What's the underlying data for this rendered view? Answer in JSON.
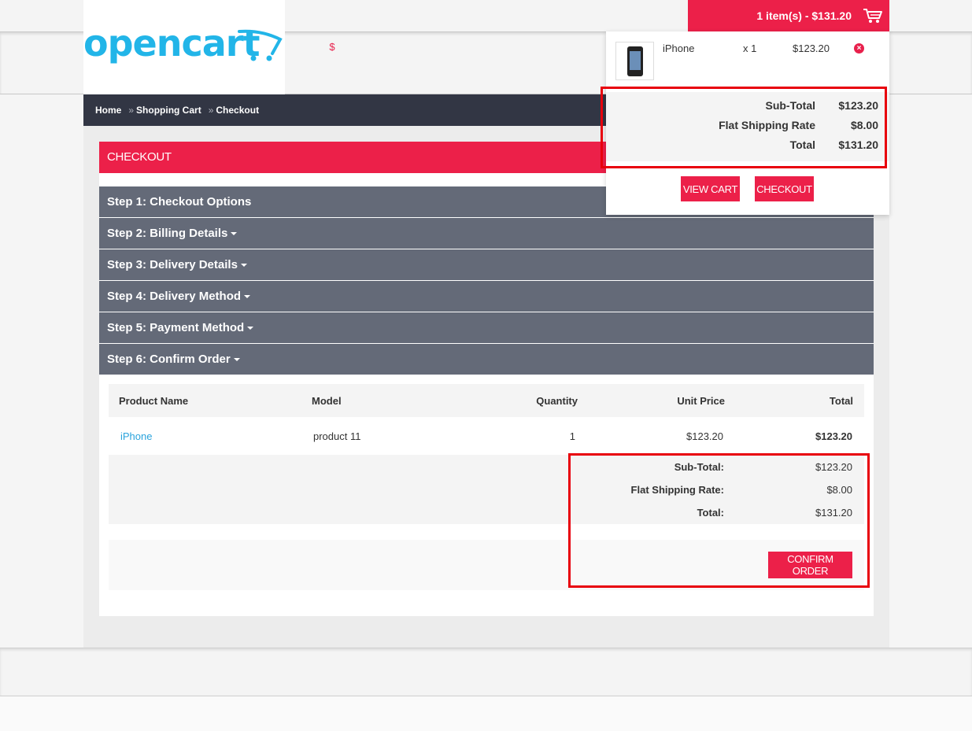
{
  "brand": {
    "logo_text": "opencart",
    "currency_symbol": "$"
  },
  "breadcrumb": {
    "items": [
      "Home",
      "Shopping Cart",
      "Checkout"
    ],
    "separator": "»"
  },
  "checkout": {
    "title": "CHECKOUT",
    "steps": [
      "Step 1: Checkout Options",
      "Step 2: Billing Details",
      "Step 3: Delivery Details",
      "Step 4: Delivery Method",
      "Step 5: Payment Method",
      "Step 6: Confirm Order"
    ],
    "table": {
      "headers": [
        "Product Name",
        "Model",
        "Quantity",
        "Unit Price",
        "Total"
      ],
      "rows": [
        {
          "name": "iPhone",
          "model": "product 11",
          "quantity": "1",
          "unit_price": "$123.20",
          "total": "$123.20"
        }
      ],
      "totals": [
        {
          "label": "Sub-Total:",
          "value": "$123.20"
        },
        {
          "label": "Flat Shipping Rate:",
          "value": "$8.00"
        },
        {
          "label": "Total:",
          "value": "$131.20"
        }
      ]
    },
    "confirm_label": "CONFIRM ORDER"
  },
  "cart": {
    "button_label": "1 item(s) - $131.20",
    "item": {
      "name": "iPhone",
      "qty": "x 1",
      "price": "$123.20",
      "remove_icon": "×"
    },
    "totals": [
      {
        "label": "Sub-Total",
        "value": "$123.20"
      },
      {
        "label": "Flat Shipping Rate",
        "value": "$8.00"
      },
      {
        "label": "Total",
        "value": "$131.20"
      }
    ],
    "view_cart_label": "VIEW CART",
    "checkout_label": "CHECKOUT"
  },
  "colors": {
    "accent": "#ec2049",
    "step_bar": "#646a78",
    "breadcrumb_bar": "#323644",
    "logo": "#22b5e8",
    "highlight": "#e8000c"
  }
}
